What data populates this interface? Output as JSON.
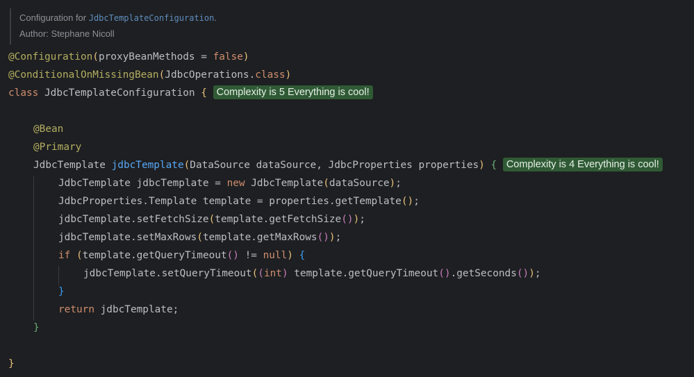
{
  "doc": {
    "line1_prefix": "Configuration for ",
    "line1_ref": "JdbcTemplateConfiguration",
    "line1_suffix": ".",
    "line2": "Author: Stephane Nicoll"
  },
  "code": {
    "l1": {
      "anno": "@Configuration",
      "open": "(",
      "arg": "proxyBeanMethods = ",
      "val": "false",
      "close": ")"
    },
    "l2": {
      "anno": "@ConditionalOnMissingBean",
      "open": "(",
      "arg": "JdbcOperations.",
      "kw": "class",
      "close": ")"
    },
    "l3": {
      "kw": "class",
      "name": " JdbcTemplateConfiguration ",
      "brace": "{"
    },
    "l4": {
      "anno": "@Bean"
    },
    "l5": {
      "anno": "@Primary"
    },
    "l6": {
      "type": "JdbcTemplate ",
      "method": "jdbcTemplate",
      "open": "(",
      "params": "DataSource dataSource, JdbcProperties properties",
      "close": ")",
      "brace": " {"
    },
    "l7": {
      "a": "JdbcTemplate jdbcTemplate = ",
      "kw": "new",
      "b": " JdbcTemplate",
      "open": "(",
      "arg": "dataSource",
      "close": ")",
      "end": ";"
    },
    "l8": {
      "a": "JdbcProperties.Template template = properties.getTemplate",
      "open": "(",
      "close": ")",
      "end": ";"
    },
    "l9": {
      "a": "jdbcTemplate.setFetchSize",
      "open": "(",
      "b": "template.getFetchSize",
      "iopen": "(",
      "iclose": ")",
      "close": ")",
      "end": ";"
    },
    "l10": {
      "a": "jdbcTemplate.setMaxRows",
      "open": "(",
      "b": "template.getMaxRows",
      "iopen": "(",
      "iclose": ")",
      "close": ")",
      "end": ";"
    },
    "l11": {
      "kw": "if",
      "sp": " ",
      "open": "(",
      "a": "template.getQueryTimeout",
      "iopen": "(",
      "iclose": ")",
      "b": " != ",
      "kw2": "null",
      "close": ")",
      "brace": " {"
    },
    "l12": {
      "a": "jdbcTemplate.setQueryTimeout",
      "open": "(",
      "copen": "(",
      "kw": "int",
      "cclose": ")",
      "b": " template.getQueryTimeout",
      "iopen": "(",
      "iclose": ")",
      "c": ".getSeconds",
      "jopen": "(",
      "jclose": ")",
      "close": ")",
      "end": ";"
    },
    "l13": {
      "brace": "}"
    },
    "l14": {
      "kw": "return",
      "a": " jdbcTemplate;"
    },
    "l15": {
      "brace": "}"
    },
    "l16": {
      "brace": "}"
    }
  },
  "badges": {
    "class_complexity": "Complexity is 5 Everything is cool!",
    "method_complexity": "Complexity is 4 Everything is cool!"
  },
  "colors": {
    "background": "#1e1f22",
    "annotation": "#b3ae60",
    "keyword": "#cf8e6d",
    "method_declaration": "#56a8f5",
    "badge_background": "#2f5a35"
  }
}
